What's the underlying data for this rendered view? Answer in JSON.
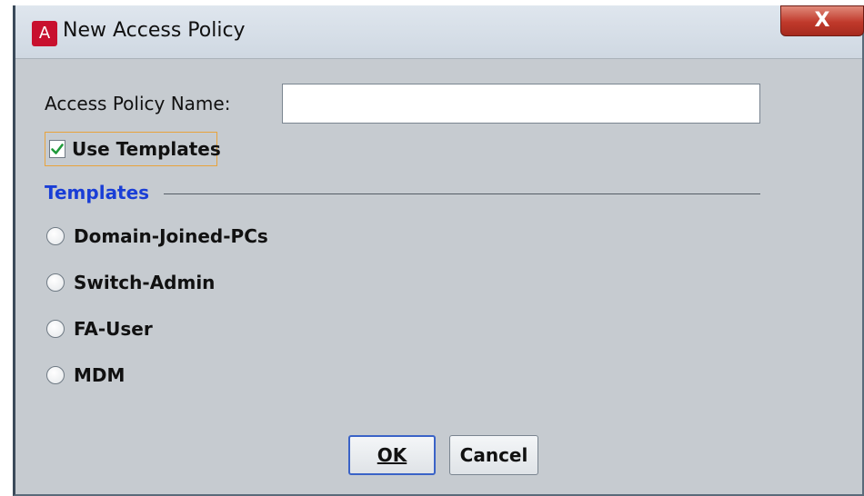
{
  "window": {
    "title": "New Access Policy",
    "app_icon_glyph": "A",
    "close_glyph": "X"
  },
  "form": {
    "name_label": "Access Policy Name:",
    "name_value": "",
    "name_placeholder": "",
    "use_templates_label": "Use Templates",
    "use_templates_checked": true
  },
  "templates": {
    "section_title": "Templates",
    "options": [
      {
        "label": "Domain-Joined-PCs",
        "selected": false
      },
      {
        "label": "Switch-Admin",
        "selected": false
      },
      {
        "label": "FA-User",
        "selected": false
      },
      {
        "label": "MDM",
        "selected": false
      }
    ]
  },
  "buttons": {
    "ok_label": "OK",
    "cancel_label": "Cancel"
  },
  "colors": {
    "section_title": "#1a3ed6",
    "focus_border": "#e8a33c",
    "checkmark": "#1f9a3a",
    "close_button": "#c0392b",
    "app_icon": "#c8102e"
  },
  "icons": {
    "app": "app-logo-icon",
    "close": "close-icon",
    "check": "checkmark-icon"
  }
}
